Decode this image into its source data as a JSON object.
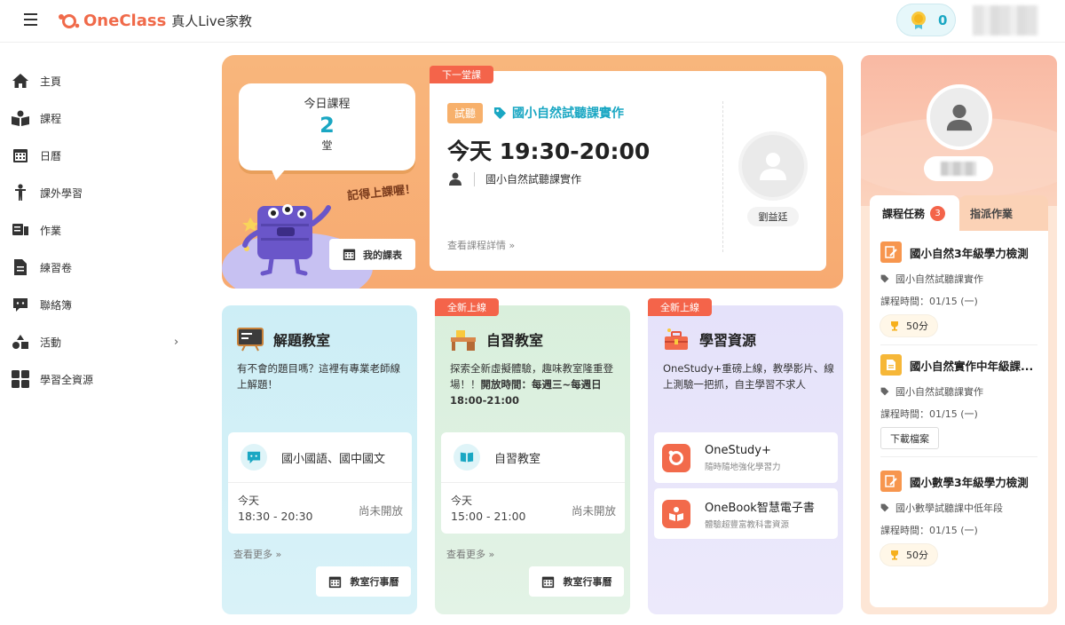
{
  "header": {
    "brand": "OneClass",
    "subtitle": "真人Live家教",
    "medal_count": "0"
  },
  "sidebar": {
    "items": [
      {
        "label": "主頁",
        "icon": "home-icon"
      },
      {
        "label": "課程",
        "icon": "book-icon"
      },
      {
        "label": "日曆",
        "icon": "calendar-icon"
      },
      {
        "label": "課外學習",
        "icon": "person-icon"
      },
      {
        "label": "作業",
        "icon": "homework-icon"
      },
      {
        "label": "練習卷",
        "icon": "document-icon"
      },
      {
        "label": "聯絡簿",
        "icon": "chat-icon"
      },
      {
        "label": "活動",
        "icon": "shapes-icon"
      },
      {
        "label": "學習全資源",
        "icon": "grid-icon"
      }
    ]
  },
  "today": {
    "title": "今日課程",
    "count": "2",
    "unit": "堂",
    "reminder": "記得上課喔！",
    "my_schedule": "我的課表"
  },
  "next_class": {
    "tag": "下一堂課",
    "trial": "試聽",
    "course": "國小自然試聽課實作",
    "time": "今天 19:30-20:00",
    "teacher_course": "國小自然試聽課實作",
    "detail_link": "查看課程詳情 »",
    "teacher_name": "劉益廷"
  },
  "cards": [
    {
      "title": "解題教室",
      "desc": "有不會的題目嗎？這裡有專業老師線上解題！",
      "room": "國小國語、國中國文",
      "day": "今天",
      "time": "18:30 - 20:30",
      "status": "尚未開放",
      "more": "查看更多 »",
      "button": "教室行事曆"
    },
    {
      "tag": "全新上線",
      "title": "自習教室",
      "desc_a": "探索全新虛擬體驗，趣味教室隆重登場！！",
      "desc_b": "開放時間：每週三~每週日 18:00-21:00",
      "room": "自習教室",
      "day": "今天",
      "time": "15:00 - 21:00",
      "status": "尚未開放",
      "more": "查看更多 »",
      "button": "教室行事曆"
    },
    {
      "tag": "全新上線",
      "title": "學習資源",
      "desc": "OneStudy+重磅上線，教學影片、線上測驗一把抓，自主學習不求人",
      "res": [
        {
          "name": "OneStudy+",
          "sub": "隨時隨地強化學習力"
        },
        {
          "name": "OneBook智慧電子書",
          "sub": "體驗超豐富教科書資源"
        }
      ]
    }
  ],
  "tasks": {
    "tab_tasks": "課程任務",
    "tab_count": "3",
    "tab_assign": "指派作業",
    "items": [
      {
        "title": "國小自然3年級學力檢測",
        "tag": "國小自然試聽課實作",
        "time": "課程時間：01/15 (一)",
        "pill": "50分",
        "color": "#f7964e"
      },
      {
        "title": "國小自然實作中年級課...",
        "tag": "國小自然試聽課實作",
        "time": "課程時間：01/15 (一)",
        "button": "下載檔案",
        "color": "#f6b738"
      },
      {
        "title": "國小數學3年級學力檢測",
        "tag": "國小數學試聽課中低年段",
        "time": "課程時間：01/15 (一)",
        "pill": "50分",
        "color": "#f7964e"
      }
    ]
  }
}
